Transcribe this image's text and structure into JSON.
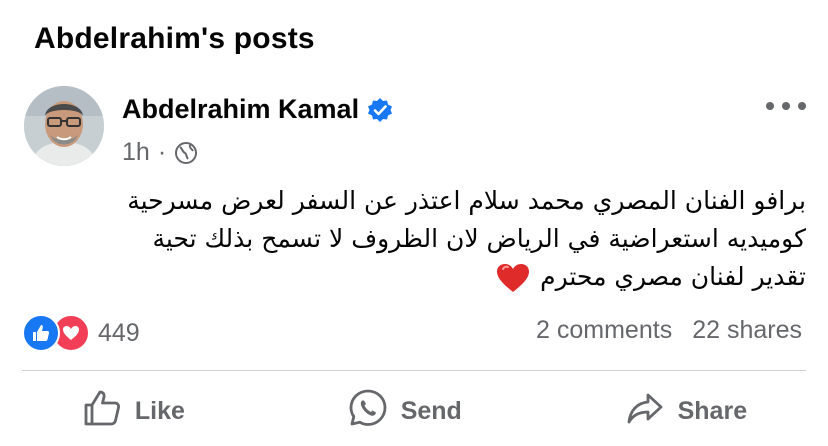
{
  "page": {
    "title": "Abdelrahim's posts"
  },
  "post": {
    "author": "Abdelrahim Kamal",
    "verified_icon": "verified-badge-icon",
    "time": "1h",
    "separator": "·",
    "privacy_icon": "globe-icon",
    "more_icon": "more-options-icon",
    "text_lines": [
      "برافو الفنان المصري محمد سلام اعتذر عن السفر لعرض مسرحية",
      "كوميديه استعراضية في الرياض لان الظروف لا تسمح  بذلك  تحية",
      "تقدير  لفنان مصري محترم"
    ],
    "emoji": "red-heart-emoji"
  },
  "engagement": {
    "reaction_icons": [
      "like-reaction-icon",
      "love-reaction-icon"
    ],
    "reaction_count": "449",
    "comments": "2 comments",
    "shares": "22 shares"
  },
  "actions": {
    "like": "Like",
    "send": "Send",
    "share": "Share"
  },
  "colors": {
    "accent": "#1877f2",
    "love": "#f33e58",
    "secondary_text": "#65676b",
    "divider": "#ced0d4"
  }
}
